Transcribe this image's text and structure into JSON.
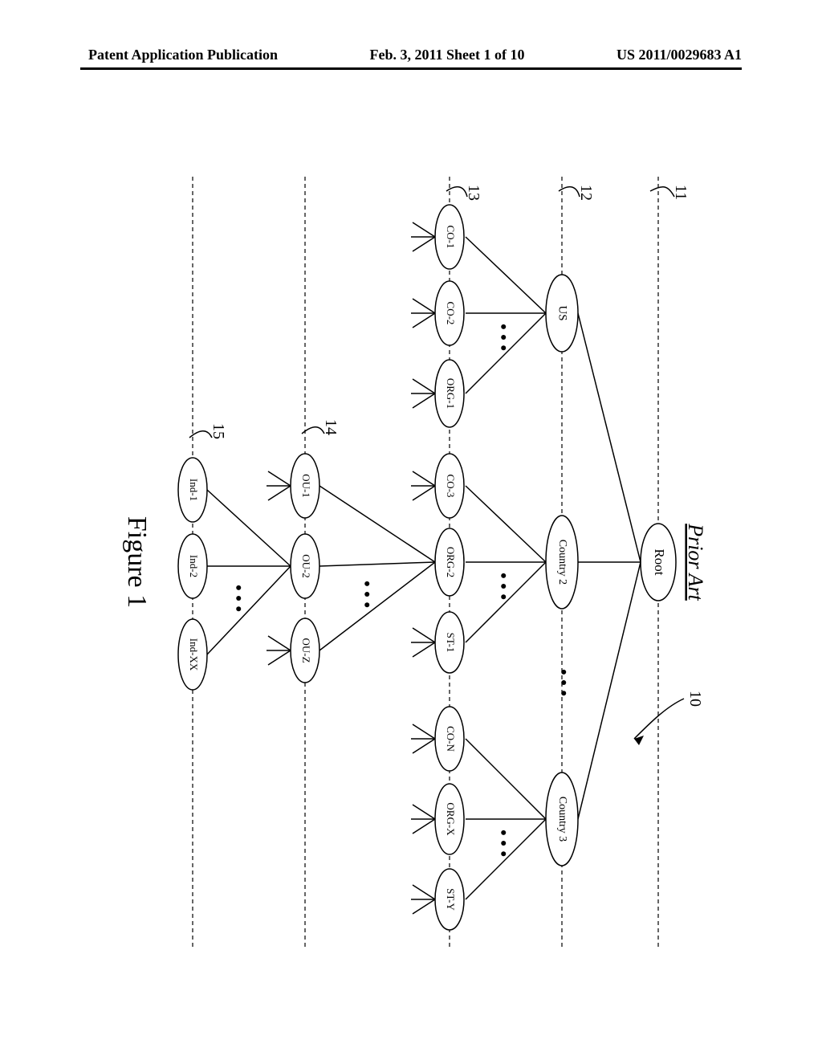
{
  "header": {
    "left": "Patent Application Publication",
    "center": "Feb. 3, 2011  Sheet 1 of 10",
    "right": "US 2011/0029683 A1"
  },
  "figure": {
    "prior_art": "Prior Art",
    "label": "Figure 1",
    "ref_10": "10",
    "ref_11": "11",
    "ref_12": "12",
    "ref_13": "13",
    "ref_14": "14",
    "ref_15": "15"
  },
  "tree": {
    "root": "Root",
    "level1": {
      "a": "US",
      "b": "Country 2",
      "c": "Country 3"
    },
    "row_us": {
      "a": "CO-1",
      "b": "CO-2",
      "c": "ORG-1"
    },
    "row_c2": {
      "a": "CO-3",
      "b": "ORG-2",
      "c": "ST-1"
    },
    "row_c3": {
      "a": "CO-N",
      "b": "ORG-X",
      "c": "ST-Y"
    },
    "row_ou": {
      "a": "OU-1",
      "b": "OU-2",
      "c": "OU-Z"
    },
    "row_ind": {
      "a": "Ind-1",
      "b": "Ind-2",
      "c": "Ind-XX"
    }
  },
  "dots": "• • •"
}
